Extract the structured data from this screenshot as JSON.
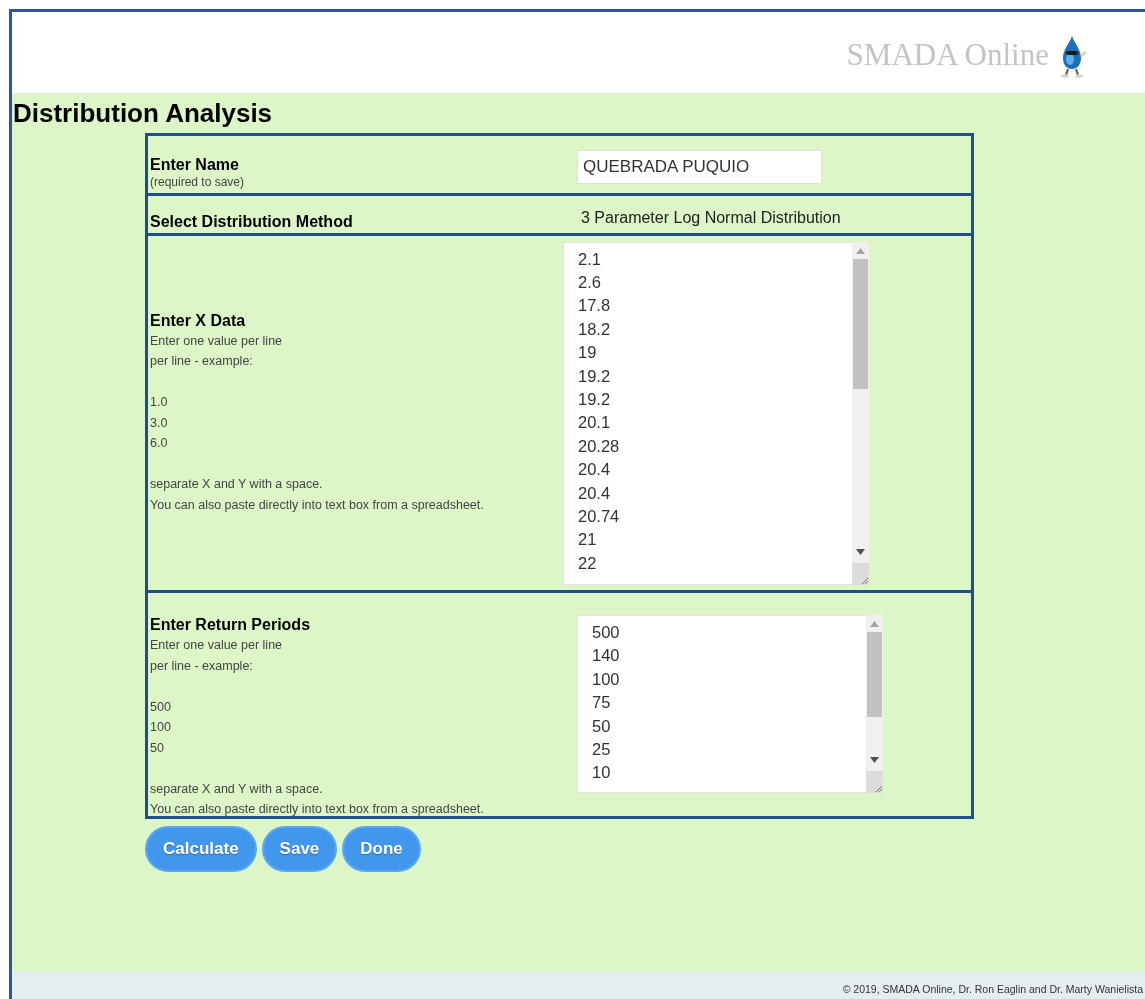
{
  "header": {
    "site_title": "SMADA Online"
  },
  "page_title": "Distribution Analysis",
  "form": {
    "rows": [
      {
        "kind": "text",
        "label": "Enter Name",
        "note": "(required to save)",
        "value": "QUEBRADA PUQUIO"
      },
      {
        "kind": "select",
        "label": "Select Distribution Method",
        "value": "3 Parameter Log Normal Distribution"
      },
      {
        "kind": "list",
        "label": "Enter X Data",
        "help": [
          [
            "Enter one value per line",
            "per line - example:"
          ],
          [
            "1.0",
            "3.0",
            "6.0"
          ],
          [
            "separate X and Y with a space.",
            "You can also paste directly into text box from a spreadsheet."
          ]
        ],
        "values": [
          "2.1",
          "2.6",
          "17.8",
          "18.2",
          "19",
          "19.2",
          "19.2",
          "20.1",
          "20.28",
          "20.4",
          "20.4",
          "20.74",
          "21",
          "22"
        ]
      },
      {
        "kind": "list",
        "label": "Enter Return Periods",
        "help": [
          [
            "Enter one value per line",
            "per line - example:"
          ],
          [
            "500",
            "100",
            "50"
          ],
          [
            "separate X and Y with a space.",
            "You can also paste directly into text box from a spreadsheet."
          ]
        ],
        "values": [
          "500",
          "140",
          "100",
          "75",
          "50",
          "25",
          "10"
        ]
      }
    ]
  },
  "buttons": [
    "Calculate",
    "Save",
    "Done"
  ],
  "footer": "© 2019, SMADA Online, Dr. Ron Eaglin and Dr. Marty Wanielista"
}
